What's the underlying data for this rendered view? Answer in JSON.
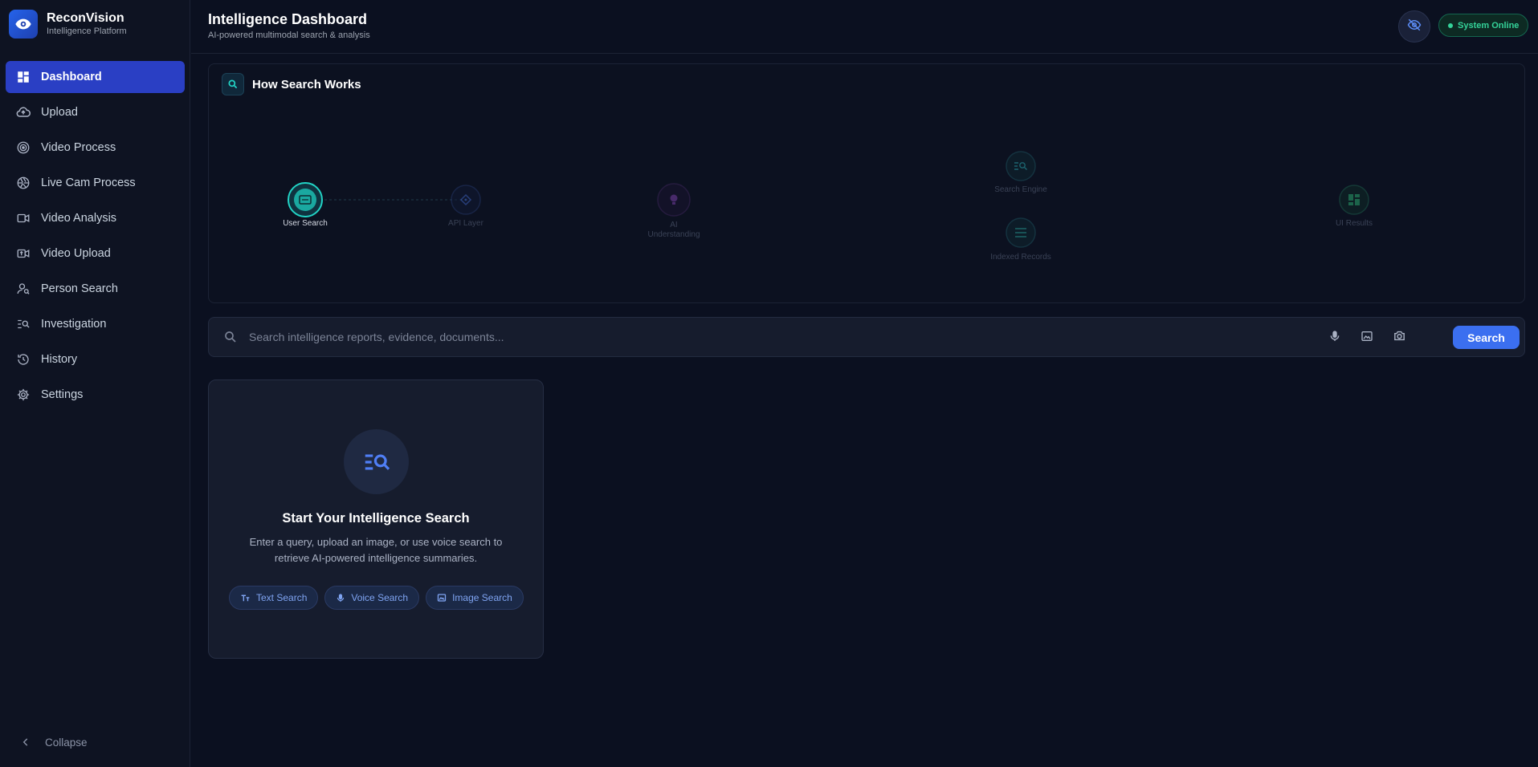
{
  "brand": {
    "name": "ReconVision",
    "subtitle": "Intelligence Platform"
  },
  "sidebar": {
    "items": [
      {
        "label": "Dashboard",
        "icon": "dashboard-icon",
        "active": true
      },
      {
        "label": "Upload",
        "icon": "cloud-upload-icon"
      },
      {
        "label": "Video Process",
        "icon": "target-icon"
      },
      {
        "label": "Live Cam Process",
        "icon": "aperture-icon"
      },
      {
        "label": "Video Analysis",
        "icon": "videocam-icon"
      },
      {
        "label": "Video Upload",
        "icon": "video-upload-icon"
      },
      {
        "label": "Person Search",
        "icon": "person-search-icon"
      },
      {
        "label": "Investigation",
        "icon": "manage-search-icon"
      },
      {
        "label": "History",
        "icon": "history-icon"
      },
      {
        "label": "Settings",
        "icon": "gear-icon"
      }
    ],
    "collapse_label": "Collapse"
  },
  "header": {
    "title": "Intelligence Dashboard",
    "subtitle": "AI-powered multimodal search & analysis",
    "status": "System Online"
  },
  "flow": {
    "title": "How Search Works",
    "nodes": [
      {
        "label": "User Search",
        "icon": "keyboard-icon"
      },
      {
        "label": "API Layer",
        "icon": "api-icon"
      },
      {
        "label": "AI Understanding",
        "label_lines": [
          "AI",
          "Understanding"
        ],
        "icon": "lightbulb-icon"
      },
      {
        "label": "Search Engine",
        "icon": "manage-search-icon"
      },
      {
        "label": "Indexed Records",
        "icon": "list-icon"
      },
      {
        "label": "UI Results",
        "icon": "dashboard-icon"
      }
    ]
  },
  "search": {
    "placeholder": "Search intelligence reports, evidence, documents...",
    "button_label": "Search"
  },
  "start": {
    "title": "Start Your Intelligence Search",
    "description": "Enter a query, upload an image, or use voice search to retrieve AI-powered intelligence summaries.",
    "chips": [
      {
        "label": "Text Search",
        "icon": "text-fields-icon"
      },
      {
        "label": "Voice Search",
        "icon": "mic-icon"
      },
      {
        "label": "Image Search",
        "icon": "image-icon"
      }
    ]
  },
  "colors": {
    "accent": "#2a3fc4",
    "primary_button": "#3b6ff0",
    "status": "#34d399",
    "teal": "#22d3c5"
  }
}
